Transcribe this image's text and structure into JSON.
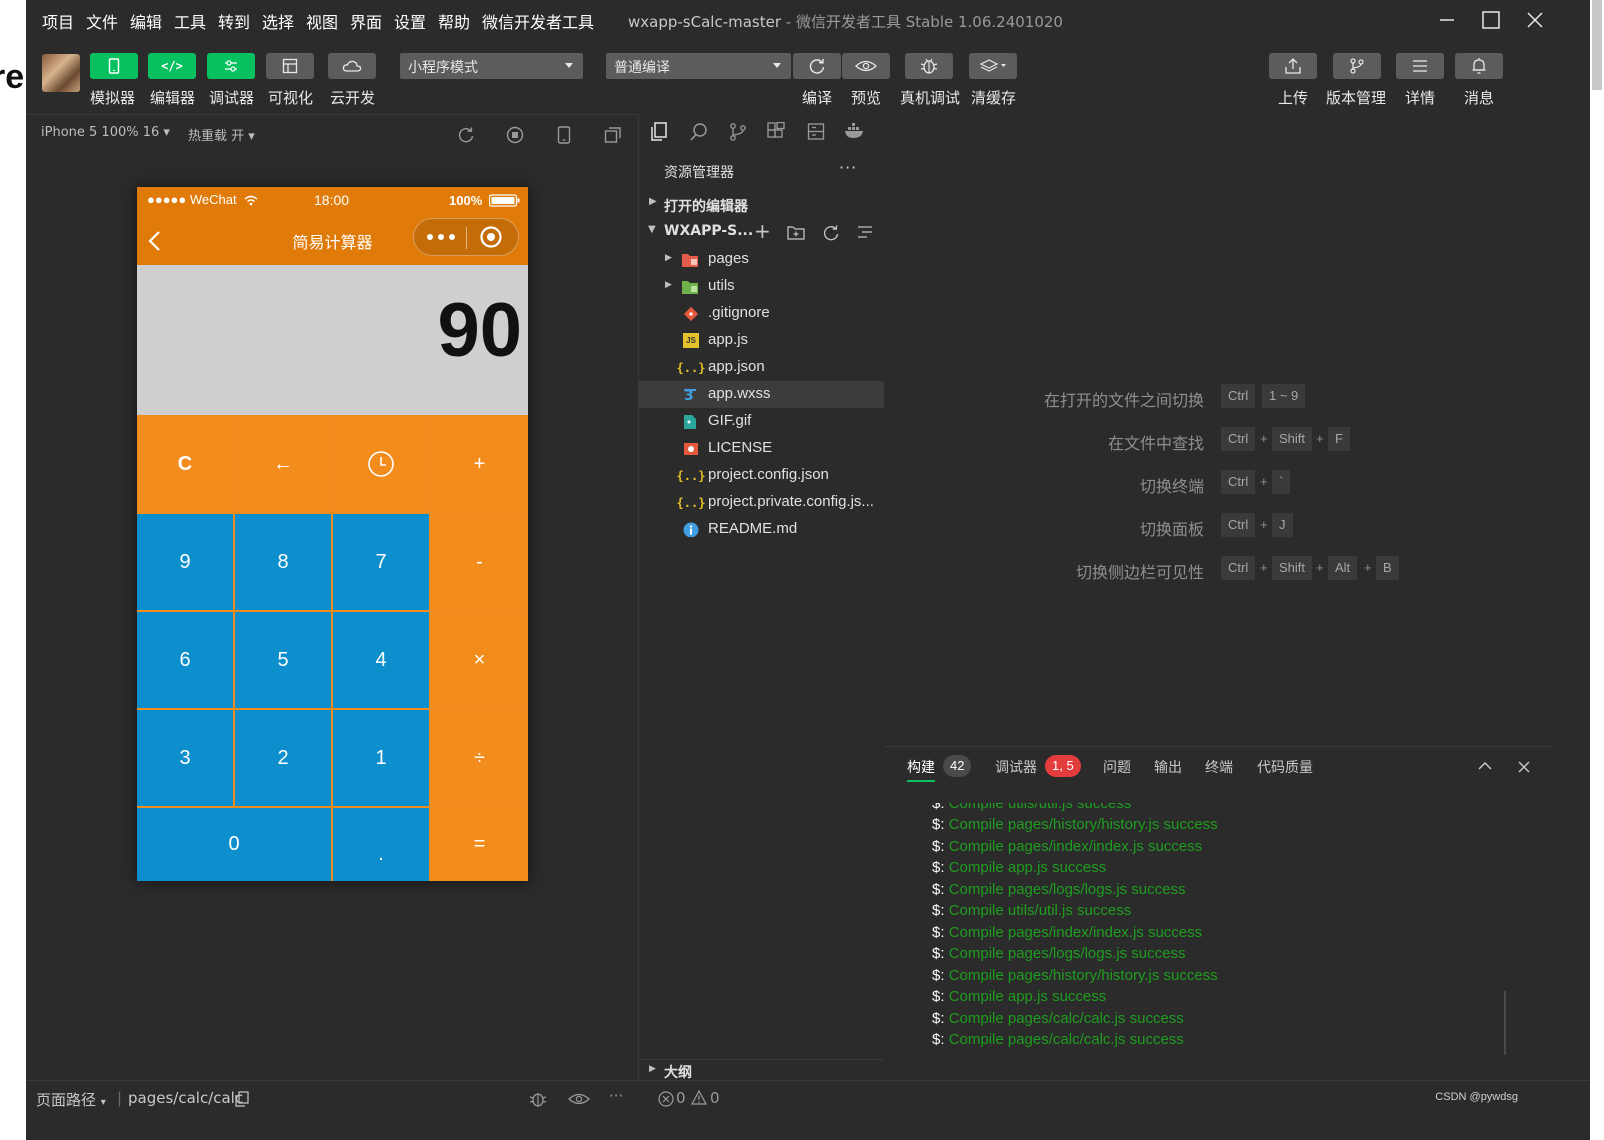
{
  "window": {
    "menu": [
      "项目",
      "文件",
      "编辑",
      "工具",
      "转到",
      "选择",
      "视图",
      "界面",
      "设置",
      "帮助",
      "微信开发者工具"
    ],
    "project_name": "wxapp-sCalc-master",
    "app_suffix": " - 微信开发者工具 Stable 1.06.2401020",
    "background_glyph": "re"
  },
  "toolbar": {
    "left_buttons": [
      {
        "label": "模拟器",
        "icon": "phone-icon"
      },
      {
        "label": "编辑器",
        "icon": "code-icon"
      },
      {
        "label": "调试器",
        "icon": "debug-sliders-icon"
      },
      {
        "label": "可视化",
        "icon": "layout-icon"
      },
      {
        "label": "云开发",
        "icon": "cloud-icon"
      }
    ],
    "mode_select": "小程序模式",
    "compile_select": "普通编译",
    "compile_label": "编译",
    "preview_label": "预览",
    "realdebug_label": "真机调试",
    "clearcache_label": "清缓存",
    "upload_label": "上传",
    "version_label": "版本管理",
    "details_label": "详情",
    "message_label": "消息"
  },
  "simulator": {
    "device": "iPhone 5 100% 16",
    "hotreload": "热重载 开",
    "phone": {
      "carrier": "●●●●● WeChat",
      "time": "18:00",
      "battery": "100%",
      "nav_title": "简易计算器",
      "display_value": "90",
      "keys": [
        "C",
        "←",
        "⊙",
        "+",
        "9",
        "8",
        "7",
        "-",
        "6",
        "5",
        "4",
        "×",
        "3",
        "2",
        "1",
        "÷",
        "0",
        ".",
        "="
      ]
    }
  },
  "explorer": {
    "title": "资源管理器",
    "more": "···",
    "open_editors": "打开的编辑器",
    "project_root": "WXAPP-S...",
    "items": [
      {
        "name": "pages",
        "type": "folder"
      },
      {
        "name": "utils",
        "type": "folder"
      },
      {
        "name": ".gitignore",
        "type": "git"
      },
      {
        "name": "app.js",
        "type": "js"
      },
      {
        "name": "app.json",
        "type": "json"
      },
      {
        "name": "app.wxss",
        "type": "css"
      },
      {
        "name": "GIF.gif",
        "type": "image"
      },
      {
        "name": "LICENSE",
        "type": "license"
      },
      {
        "name": "project.config.json",
        "type": "json"
      },
      {
        "name": "project.private.config.js...",
        "type": "json"
      },
      {
        "name": "README.md",
        "type": "info"
      }
    ],
    "outline": "大纲"
  },
  "shortcuts": [
    {
      "label": "在打开的文件之间切换",
      "keys": [
        "Ctrl",
        "1 ~ 9"
      ]
    },
    {
      "label": "在文件中查找",
      "keys": [
        "Ctrl",
        "Shift",
        "F"
      ]
    },
    {
      "label": "切换终端",
      "keys": [
        "Ctrl",
        "`"
      ]
    },
    {
      "label": "切换面板",
      "keys": [
        "Ctrl",
        "J"
      ]
    },
    {
      "label": "切换侧边栏可见性",
      "keys": [
        "Ctrl",
        "Shift",
        "Alt",
        "B"
      ]
    }
  ],
  "console": {
    "tabs": [
      "构建",
      "调试器",
      "问题",
      "输出",
      "终端",
      "代码质量"
    ],
    "build_count": "42",
    "debugger_badge": "1, 5",
    "prompt": "$:",
    "logs": [
      "Compile utils/util.js success",
      "Compile pages/history/history.js success",
      "Compile pages/index/index.js success",
      "Compile app.js success",
      "Compile pages/logs/logs.js success",
      "Compile utils/util.js success",
      "Compile pages/index/index.js success",
      "Compile pages/logs/logs.js success",
      "Compile pages/history/history.js success",
      "Compile app.js success",
      "Compile pages/calc/calc.js success",
      "Compile pages/calc/calc.js success"
    ]
  },
  "statusbar": {
    "page_path_label": "页面路径",
    "page_path": "pages/calc/calc",
    "errors": "0",
    "warnings": "0",
    "watermark": "CSDN @pywdsg"
  },
  "colors": {
    "accent_green": "#07c160",
    "orange_key": "#f28c1c",
    "blue_key": "#0c8fcc",
    "log_green": "#1f9d1f",
    "error_badge": "#e23c3c"
  }
}
